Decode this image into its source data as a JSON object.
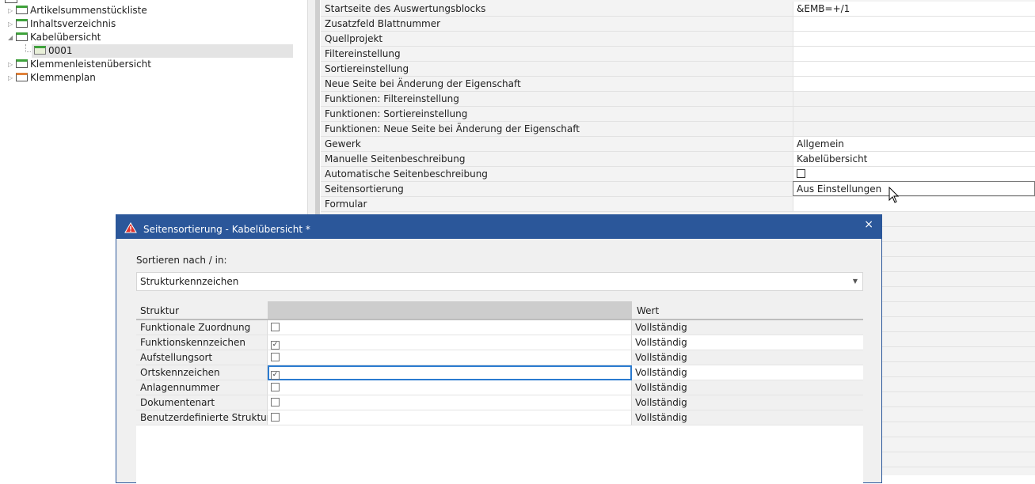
{
  "tree": {
    "items": [
      {
        "label": "Artikelsummenstückliste",
        "folder": "green"
      },
      {
        "label": "Inhaltsverzeichnis",
        "folder": "green"
      },
      {
        "label": "Kabelübersicht",
        "folder": "green",
        "expanded": true
      },
      {
        "label": "0001",
        "folder": "open",
        "selected": true
      },
      {
        "label": "Klemmenleistenübersicht",
        "folder": "green"
      },
      {
        "label": "Klemmenplan",
        "folder": "orange"
      }
    ]
  },
  "properties": {
    "rows": [
      {
        "name": "Startseite des Auswertungsblocks",
        "value": "&EMB=+/1"
      },
      {
        "name": "Zusatzfeld Blattnummer",
        "value": ""
      },
      {
        "name": "Quellprojekt",
        "value": ""
      },
      {
        "name": "Filtereinstellung",
        "value": ""
      },
      {
        "name": "Sortiereinstellung",
        "value": ""
      },
      {
        "name": "Neue Seite bei Änderung der Eigenschaft",
        "value": ""
      },
      {
        "name": "Funktionen: Filtereinstellung",
        "value": ""
      },
      {
        "name": "Funktionen: Sortiereinstellung",
        "value": ""
      },
      {
        "name": "Funktionen: Neue Seite bei Änderung der Eigenschaft",
        "value": ""
      },
      {
        "name": "Gewerk",
        "value": "Allgemein"
      },
      {
        "name": "Manuelle Seitenbeschreibung",
        "value": "Kabelübersicht"
      },
      {
        "name": "Automatische Seitenbeschreibung",
        "value": ""
      },
      {
        "name": "Seitensortierung",
        "value": "Aus Einstellungen"
      },
      {
        "name": "Formular",
        "value": ""
      }
    ]
  },
  "dialog": {
    "title": "Seitensortierung - Kabelübersicht *",
    "close_glyph": "×",
    "sort_label": "Sortieren nach / in:",
    "sort_value": "Strukturkennzeichen",
    "grid": {
      "headers": [
        "Struktur",
        "",
        "Wert"
      ],
      "rows": [
        {
          "struktur": "Funktionale Zuordnung",
          "checked": false,
          "wert": "Vollständig"
        },
        {
          "struktur": "Funktionskennzeichen",
          "checked": true,
          "wert": "Vollständig"
        },
        {
          "struktur": "Aufstellungsort",
          "checked": false,
          "wert": "Vollständig"
        },
        {
          "struktur": "Ortskennzeichen",
          "checked": true,
          "wert": "Vollständig"
        },
        {
          "struktur": "Anlagennummer",
          "checked": false,
          "wert": "Vollständig"
        },
        {
          "struktur": "Dokumentenart",
          "checked": false,
          "wert": "Vollständig"
        },
        {
          "struktur": "Benutzerdefinierte Struktur",
          "checked": false,
          "wert": "Vollständig"
        }
      ]
    }
  },
  "colors": {
    "accent": "#2b579a",
    "warning": "#e0312b",
    "focus": "#2b7bd0"
  }
}
